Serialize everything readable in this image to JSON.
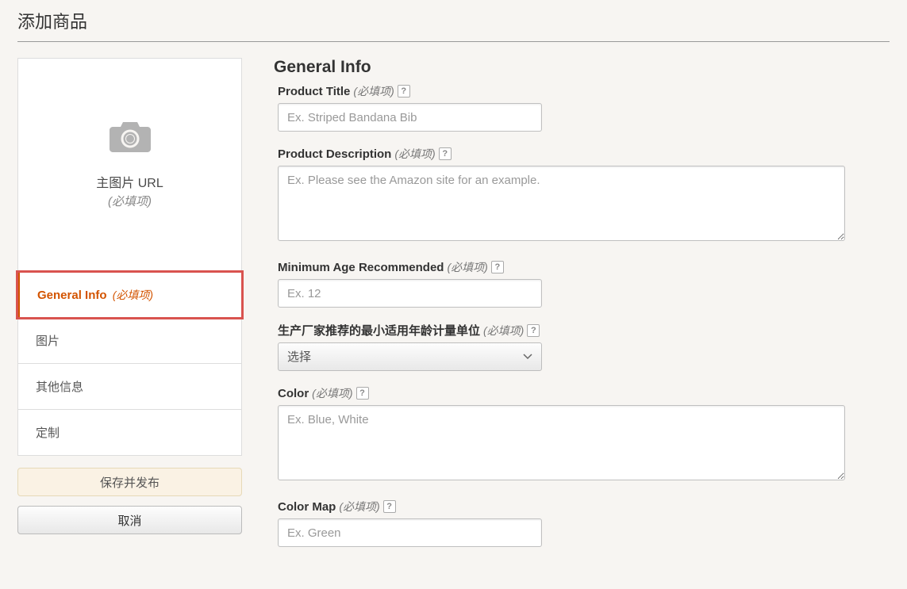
{
  "page": {
    "title": "添加商品"
  },
  "sidebar": {
    "image_label": "主图片 URL",
    "image_required": "(必填项)",
    "nav": [
      {
        "label": "General Info",
        "required": "(必填项)",
        "active": true
      },
      {
        "label": "图片",
        "required": "",
        "active": false
      },
      {
        "label": "其他信息",
        "required": "",
        "active": false
      },
      {
        "label": "定制",
        "required": "",
        "active": false
      }
    ],
    "save_btn": "保存并发布",
    "cancel_btn": "取消"
  },
  "form": {
    "section_title": "General Info",
    "required_suffix": "(必填项)",
    "fields": {
      "product_title": {
        "label": "Product Title",
        "placeholder": "Ex. Striped Bandana Bib"
      },
      "product_description": {
        "label": "Product Description",
        "placeholder": "Ex. Please see the Amazon site for an example."
      },
      "min_age": {
        "label": "Minimum Age Recommended",
        "placeholder": "Ex. 12"
      },
      "age_unit": {
        "label": "生产厂家推荐的最小适用年龄计量单位",
        "value": "选择"
      },
      "color": {
        "label": "Color",
        "placeholder": "Ex. Blue, White"
      },
      "color_map": {
        "label": "Color Map",
        "placeholder": "Ex. Green"
      }
    }
  }
}
